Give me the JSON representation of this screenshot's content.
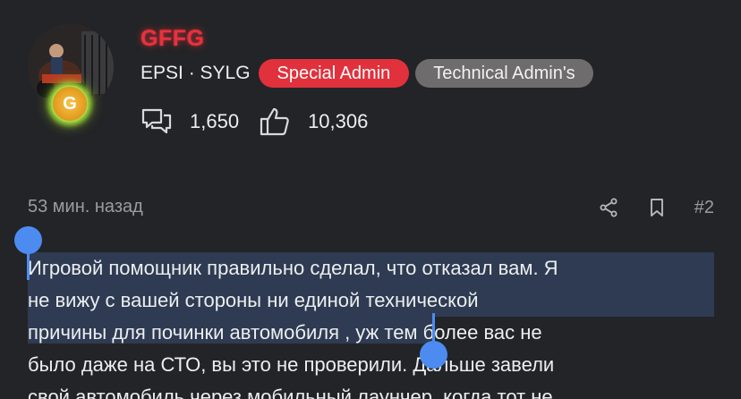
{
  "profile": {
    "username": "GFFG",
    "subtitle": "EPSI · SYLG",
    "badges": [
      {
        "label": "Special Admin",
        "color": "#e1313c"
      },
      {
        "label": "Technical Admin's",
        "color": "#6e6c6d"
      }
    ],
    "rank_badge_letter": "G",
    "messages_count": "1,650",
    "likes_count": "10,306",
    "icons": {
      "messages": "speech-bubbles-icon",
      "likes": "thumbs-up-icon"
    }
  },
  "post": {
    "time": "53 мин. назад",
    "number": "#2",
    "actions": {
      "share": "share-icon",
      "bookmark": "bookmark-icon"
    },
    "lines": [
      "Игровой помощник правильно сделал, что отказал вам. Я",
      "не вижу с вашей стороны ни единой технической",
      "причины для починки автомобиля",
      ", уж тем более вас не",
      "было даже на СТО, вы это не проверили. Дальше завели",
      "свой автомобиль через мобильный лаунчер, когда тот не"
    ],
    "selection_color": "#2e3b52",
    "handle_color": "#4c8cf0"
  }
}
